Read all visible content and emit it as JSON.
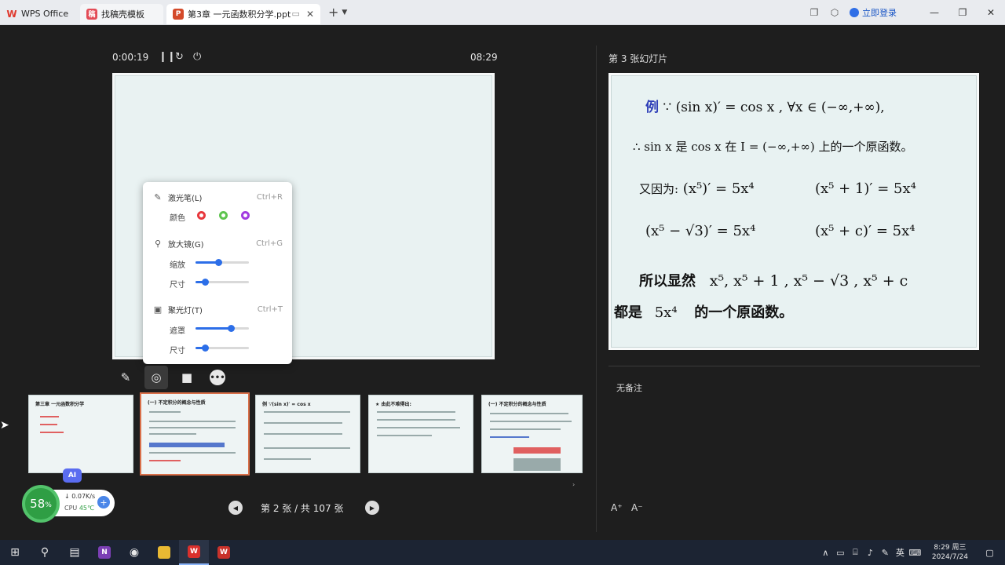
{
  "tabs": [
    {
      "label": "WPS Office",
      "icon": "wps-logo-icon"
    },
    {
      "label": "找稿壳模板",
      "icon": "template-app-icon"
    },
    {
      "label": "第3章 一元函数积分学.ppt",
      "icon": "ppt-file-icon"
    }
  ],
  "titlebar": {
    "login": "立即登录"
  },
  "presenter": {
    "elapsed": "0:00:19",
    "clock": "08:29",
    "next_title": "第 3 张幻灯片",
    "notes": "无备注",
    "nav_label": "第 2 张 / 共 107 张"
  },
  "tools_popup": {
    "laser": {
      "label": "激光笔(L)",
      "shortcut": "Ctrl+R",
      "color_label": "颜色",
      "colors": [
        "#e8383d",
        "#5ec44f",
        "#a23be0"
      ]
    },
    "magnifier": {
      "label": "放大镜(G)",
      "shortcut": "Ctrl+G",
      "zoom_label": "缩放",
      "zoom_level": 0.42,
      "size_label": "尺寸",
      "size_level": 0.18
    },
    "spotlight": {
      "label": "聚光灯(T)",
      "shortcut": "Ctrl+T",
      "mask_label": "遮罩",
      "mask_level": 0.66,
      "size_label": "尺寸",
      "size_level": 0.18
    }
  },
  "next_slide": {
    "line1_ex": "例",
    "line1": "∵ (sin x)′ = cos x ,  ∀x ∈ (−∞,+∞),",
    "line2": "∴ sin x  是 cos x 在 I = (−∞,+∞) 上的一个原函数。",
    "line3_label": "又因为:",
    "line3a": "(x⁵)′ = 5x⁴",
    "line3b": "(x⁵ + 1)′ = 5x⁴",
    "line4a": "(x⁵ − √3)′ = 5x⁴",
    "line4b": "(x⁵ + c)′ = 5x⁴",
    "line5_label": "所以显然",
    "line5": "x⁵, x⁵ + 1 , x⁵ − √3 , x⁵ + c",
    "line6_label": "都是",
    "line6_expr": "5x⁴",
    "line6_tail": "的一个原函数。"
  },
  "thumbnails": [
    {
      "title": "第三章  一元函数积分学"
    },
    {
      "title": "(一) 不定积分的概念与性质"
    },
    {
      "title": "例 ∵(sin x)′ = cos x"
    },
    {
      "title": "★ 由此不难得出:"
    },
    {
      "title": "(一) 不定积分的概念与性质"
    }
  ],
  "widgets": {
    "ai": "AI",
    "cpu_percent": "58",
    "percent_sign": "%",
    "net_speed": "↓ 0.07K/s",
    "cpu_label": "CPU",
    "cpu_temp": "45℃"
  },
  "taskbar": {
    "ime": "英",
    "time": "8:29 周三",
    "date": "2024/7/24"
  }
}
